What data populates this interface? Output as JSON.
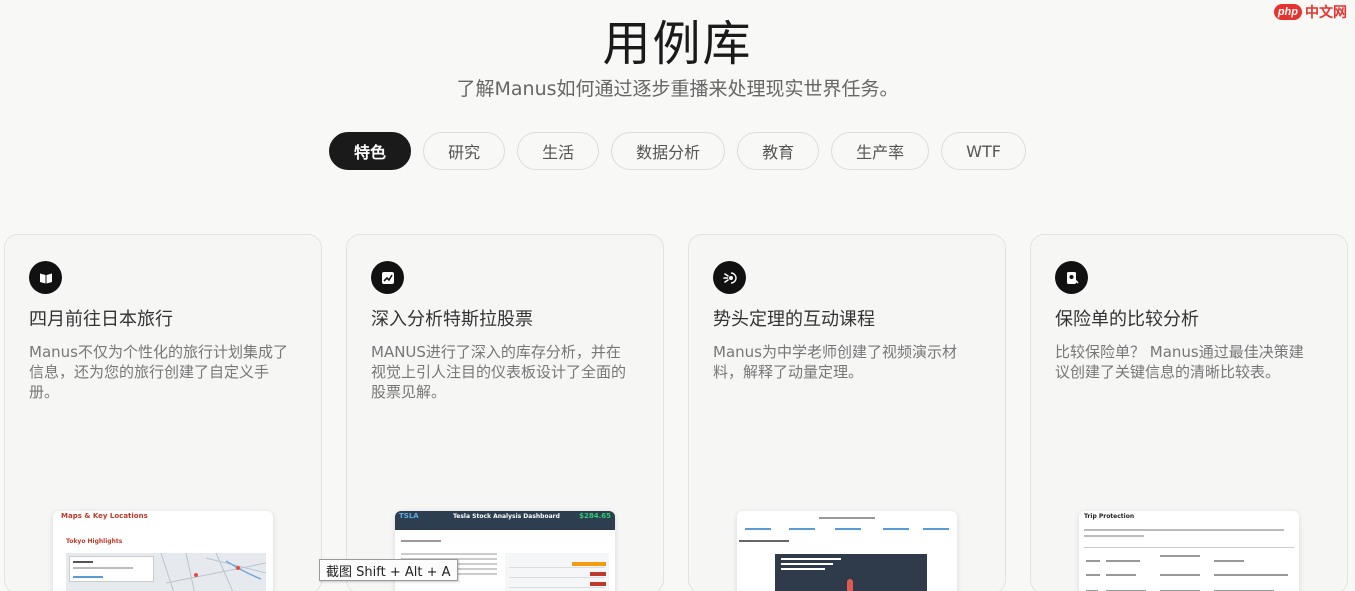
{
  "watermark": {
    "badge": "php",
    "text": "中文网"
  },
  "header": {
    "title": "用例库",
    "subtitle": "了解Manus如何通过逐步重播来处理现实世界任务。"
  },
  "tabs": [
    {
      "label": "特色",
      "active": true
    },
    {
      "label": "研究",
      "active": false
    },
    {
      "label": "生活",
      "active": false
    },
    {
      "label": "数据分析",
      "active": false
    },
    {
      "label": "教育",
      "active": false
    },
    {
      "label": "生产率",
      "active": false
    },
    {
      "label": "WTF",
      "active": false
    }
  ],
  "cards": [
    {
      "icon": "book-icon",
      "title": "四月前往日本旅行",
      "desc": "Manus不仅为个性化的旅行计划集成了信息，还为您的旅行创建了自定义手册。",
      "preview": {
        "heading": "Maps & Key Locations",
        "sub": "Tokyo Highlights"
      }
    },
    {
      "icon": "chart-icon",
      "title": "深入分析特斯拉股票",
      "desc": "MANUS进行了深入的库存分析，并在视觉上引人注目的仪表板设计了全面的股票见解。",
      "preview": {
        "ticker": "TSLA",
        "heading": "Tesla Stock Analysis Dashboard",
        "price": "$284.65"
      }
    },
    {
      "icon": "atom-icon",
      "title": "势头定理的互动课程",
      "desc": "Manus为中学老师创建了视频演示材料，解释了动量定理。",
      "preview": {}
    },
    {
      "icon": "document-icon",
      "title": "保险单的比较分析",
      "desc": "比较保险单？ Manus通过最佳决策建议创建了关键信息的清晰比较表。",
      "preview": {
        "heading": "Trip Protection"
      }
    }
  ],
  "tooltip": {
    "text": "截图 Shift + Alt + A"
  },
  "colors": {
    "active_tab": "#1a1a1a",
    "accent_red": "#c0392b",
    "background": "#f8f8f7"
  }
}
